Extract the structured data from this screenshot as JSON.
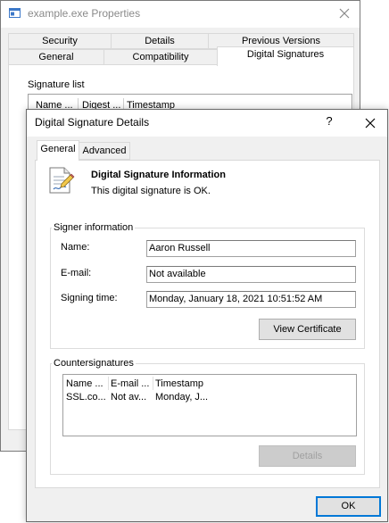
{
  "properties_window": {
    "title": "example.exe Properties",
    "tabs_row_back": [
      "Security",
      "Details",
      "Previous Versions"
    ],
    "tabs_row_front": [
      "General",
      "Compatibility",
      "Digital Signatures"
    ],
    "active_tab": "Digital Signatures",
    "signature_list_label": "Signature list",
    "signature_list_columns": [
      "Name ...",
      "Digest ...",
      "Timestamp"
    ]
  },
  "dialog": {
    "title": "Digital Signature Details",
    "help_glyph": "?",
    "tabs": [
      "General",
      "Advanced"
    ],
    "active_tab": "General",
    "info_title": "Digital Signature Information",
    "info_status": "This digital signature is OK.",
    "signer_group_label": "Signer information",
    "signer": {
      "name_label": "Name:",
      "name_value": "Aaron Russell",
      "email_label": "E-mail:",
      "email_value": "Not available",
      "time_label": "Signing time:",
      "time_value": "Monday, January 18, 2021 10:51:52 AM"
    },
    "view_certificate_label": "View Certificate",
    "countersignatures_label": "Countersignatures",
    "countersig_columns": [
      "Name ...",
      "E-mail ...",
      "Timestamp"
    ],
    "countersig_rows": [
      [
        "SSL.co...",
        "Not av...",
        "Monday, J..."
      ]
    ],
    "details_label": "Details",
    "ok_label": "OK"
  },
  "colors": {
    "window_bg": "#f0f0f0",
    "panel_bg": "#ffffff",
    "focus_border": "#0078d7",
    "disabled_text": "#a0a0a0"
  },
  "icons": {
    "app_icon": "application-window-icon",
    "close": "close-icon",
    "certificate": "signed-document-icon"
  }
}
